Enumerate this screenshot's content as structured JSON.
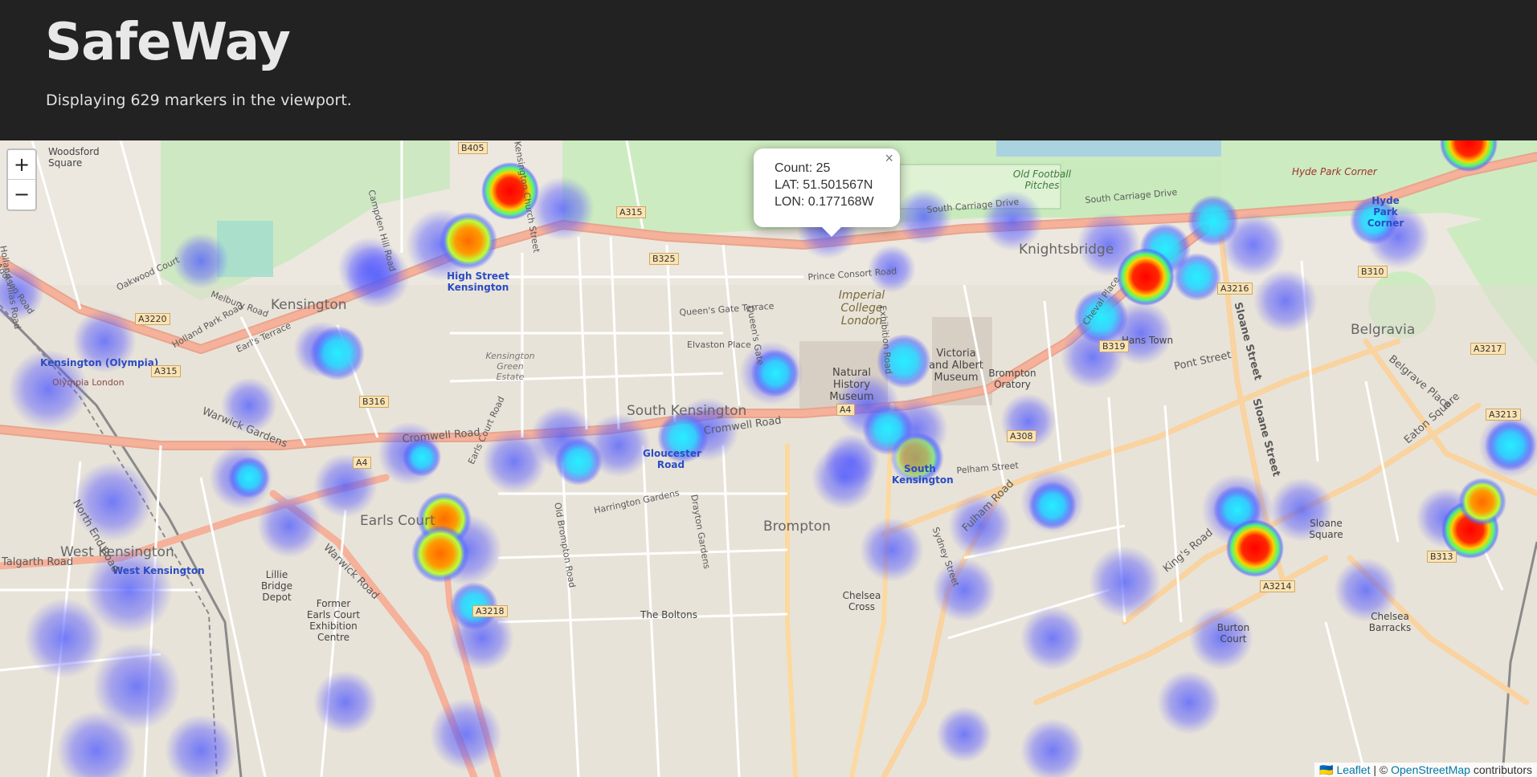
{
  "header": {
    "title": "SafeWay",
    "subtitle": "Displaying 629 markers in the viewport."
  },
  "map": {
    "zoom_in": "+",
    "zoom_out": "−",
    "labels": {
      "districts": [
        "Kensington",
        "Knightsbridge",
        "Belgravia",
        "South Kensington",
        "Brompton",
        "West Kensington",
        "Earls Court",
        "Hans Town"
      ],
      "places": [
        "Woodsford Square",
        "Kensington (Olympia)",
        "Olympia London",
        "High Street Kensington",
        "Imperial College London",
        "Natural History Museum",
        "Victoria and Albert Museum",
        "Brompton Oratory",
        "Gloucester Road",
        "South Kensington",
        "West Kensington",
        "Chelsea Cross",
        "The Boltons",
        "Sloane Square",
        "Hyde Park Corner",
        "Hyde Park Corner",
        "Old Football Pitches",
        "Chelsea Barracks",
        "Lillie Bridge Depot",
        "Former Earls Court Exhibition Centre",
        "Kensington Green Estate",
        "Burton Court"
      ],
      "roads": [
        "B405",
        "A315",
        "B325",
        "A3220",
        "A315",
        "B316",
        "A4",
        "A4",
        "A308",
        "A3216",
        "B319",
        "B310",
        "A3217",
        "A3213",
        "B313",
        "A3214",
        "A3218"
      ],
      "streets": [
        "Holland Villas Road",
        "Addison Road",
        "Oakwood Court",
        "Melbury Road",
        "Holland Park Road",
        "Earl's Terrace",
        "Warwick Gardens",
        "Warwick Road",
        "Pont Street",
        "Cromwell Road",
        "Cromwell Road",
        "Sloane Street",
        "Sloane Street",
        "Eaton Square",
        "Belgrave Place",
        "King's Road",
        "Fulham Road",
        "Sydney Street",
        "Talgarth Road",
        "North End Road",
        "South Carriage Drive",
        "South Carriage Drive",
        "Prince Consort Road",
        "Queen's Gate Terrace",
        "Elvaston Place",
        "Queen's Gate",
        "Exhibition Road",
        "Cheval Place",
        "Kensington Church Street",
        "Campden Hill Road",
        "Pelham Street",
        "Drayton Gardens",
        "Earls Court Road",
        "Old Brompton Road",
        "Harrington Gardens"
      ]
    },
    "popup": {
      "count_label": "Count: 25",
      "lat_label": "LAT: 51.501567N",
      "lon_label": "LON: 0.177168W",
      "close": "×"
    },
    "attribution": {
      "flag": "🇺🇦",
      "leaflet": "Leaflet",
      "separator": " | © ",
      "osm": "OpenStreetMap",
      "suffix": " contributors"
    },
    "heat_colors": {
      "low": "#5a5aff",
      "mid": "#38e0ff",
      "high": "#ff0000",
      "mid_high": "#ffb000"
    }
  }
}
